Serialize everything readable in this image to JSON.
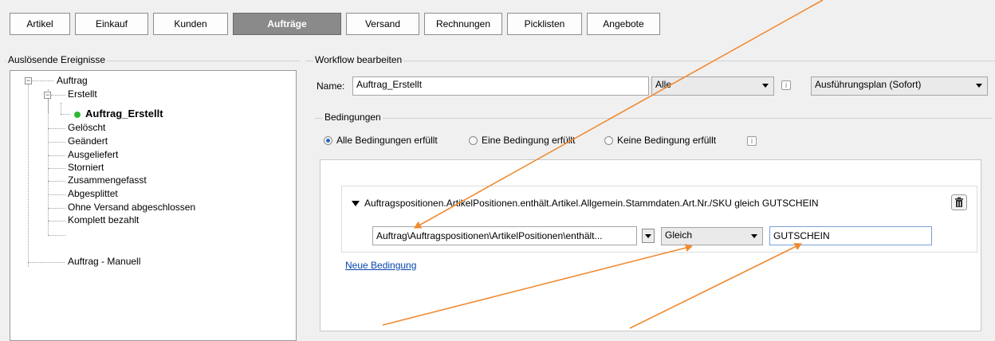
{
  "tabs": [
    {
      "label": "Artikel",
      "active": false
    },
    {
      "label": "Einkauf",
      "active": false
    },
    {
      "label": "Kunden",
      "active": false
    },
    {
      "label": "Aufträge",
      "active": true
    },
    {
      "label": "Versand",
      "active": false
    },
    {
      "label": "Rechnungen",
      "active": false
    },
    {
      "label": "Picklisten",
      "active": false
    },
    {
      "label": "Angebote",
      "active": false
    }
  ],
  "left_group": {
    "title": "Auslösende Ereignisse",
    "tree": {
      "root": "Auftrag",
      "erstellt": "Erstellt",
      "selected": "Auftrag_Erstellt",
      "events": [
        "Gelöscht",
        "Geändert",
        "Ausgeliefert",
        "Storniert",
        "Zusammengefasst",
        "Abgesplittet",
        "Ohne Versand abgeschlossen",
        "Komplett bezahlt"
      ],
      "manual": "Auftrag - Manuell"
    }
  },
  "workflow": {
    "title": "Workflow bearbeiten",
    "name_label": "Name:",
    "name_value": "Auftrag_Erstellt",
    "scope_value": "Alle",
    "plan_value": "Ausführungsplan (Sofort)"
  },
  "conditions": {
    "title": "Bedingungen",
    "radios": [
      {
        "label": "Alle Bedingungen erfüllt",
        "checked": true
      },
      {
        "label": "Eine Bedingung erfüllt",
        "checked": false
      },
      {
        "label": "Keine Bedingung erfüllt",
        "checked": false
      }
    ],
    "rule_summary": "Auftragspositionen.ArtikelPositionen.enthält.Artikel.Allgemein.Stammdaten.Art.Nr./SKU gleich GUTSCHEIN",
    "path_value": "Auftrag\\Auftragspositionen\\ArtikelPositionen\\enthält...",
    "operator_value": "Gleich",
    "compare_value": "GUTSCHEIN",
    "new_condition_link": "Neue Bedingung"
  },
  "icons": {
    "info": "info-icon",
    "trash": "trash-icon",
    "expand": "expander-icon",
    "status": "status-dot-icon"
  },
  "colors": {
    "active_tab": "#8a8a8a",
    "annotation_arrow": "#f08a30",
    "status_dot": "#2eb82e",
    "link": "#0645ad"
  }
}
